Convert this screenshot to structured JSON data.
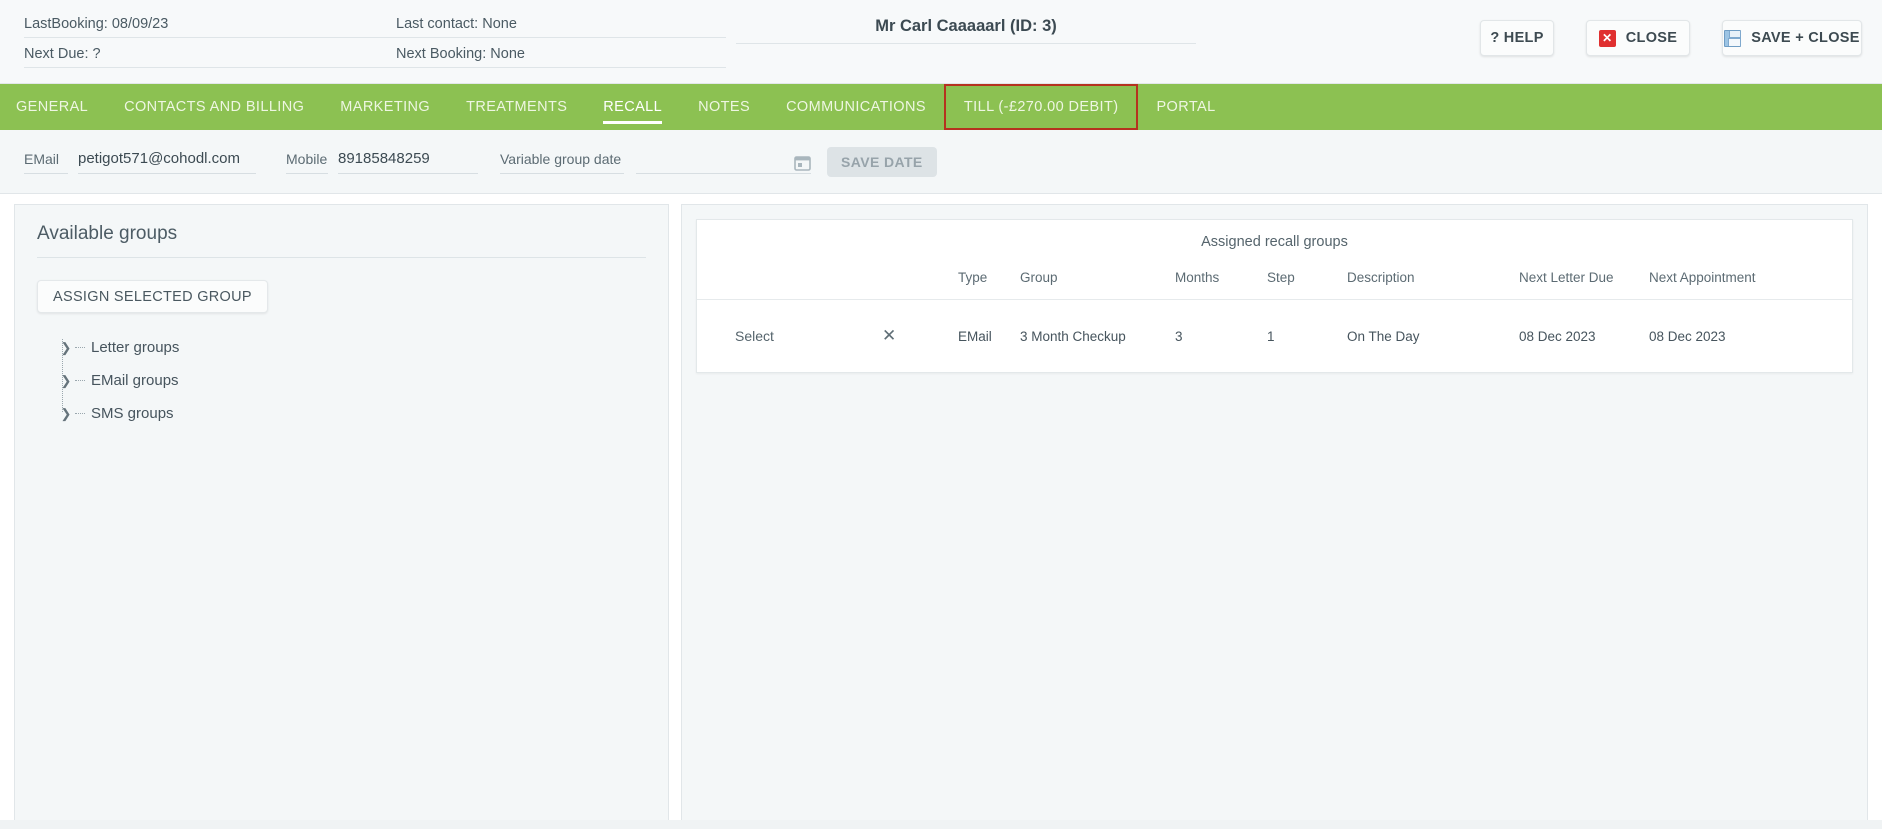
{
  "header": {
    "info_left": [
      "LastBooking: 08/09/23",
      "Next Due: ?"
    ],
    "info_mid": [
      "Last contact: None",
      "Next Booking: None"
    ],
    "patient_title": "Mr Carl Caaaaarl (ID: 3)",
    "buttons": {
      "help": "? HELP",
      "close": "CLOSE",
      "save_close": "SAVE + CLOSE"
    },
    "icons": {
      "close": "close-x-icon",
      "save": "floppy-disk-icon"
    }
  },
  "tabs": [
    {
      "label": "GENERAL",
      "active": false,
      "boxed": false
    },
    {
      "label": "CONTACTS AND BILLING",
      "active": false,
      "boxed": false
    },
    {
      "label": "MARKETING",
      "active": false,
      "boxed": false
    },
    {
      "label": "TREATMENTS",
      "active": false,
      "boxed": false
    },
    {
      "label": "RECALL",
      "active": true,
      "boxed": false
    },
    {
      "label": "NOTES",
      "active": false,
      "boxed": false
    },
    {
      "label": "COMMUNICATIONS",
      "active": false,
      "boxed": false
    },
    {
      "label": "TILL (-£270.00 DEBIT)",
      "active": false,
      "boxed": true
    },
    {
      "label": "PORTAL",
      "active": false,
      "boxed": false
    }
  ],
  "form": {
    "email_label": "EMail",
    "email_value": "petigot571@cohodl.com",
    "mobile_label": "Mobile",
    "mobile_value": "89185848259",
    "variable_group_date_label": "Variable group date",
    "date_value": "",
    "date_placeholder": "",
    "calendar_icon": "calendar-icon",
    "save_date_label": "SAVE DATE",
    "save_date_enabled": false
  },
  "left_panel": {
    "title": "Available groups",
    "assign_button": "ASSIGN SELECTED GROUP",
    "tree": [
      {
        "label": "Letter groups",
        "expanded": false
      },
      {
        "label": "EMail groups",
        "expanded": false
      },
      {
        "label": "SMS groups",
        "expanded": false
      }
    ]
  },
  "right_panel": {
    "caption": "Assigned recall groups",
    "columns": [
      "",
      "",
      "Type",
      "Group",
      "Months",
      "Step",
      "Description",
      "Next Letter Due",
      "Next Appointment"
    ],
    "rows": [
      {
        "select": "Select",
        "remove": "✕",
        "type": "EMail",
        "group": "3 Month Checkup",
        "months": "3",
        "step": "1",
        "description": "On The Day",
        "next_letter_due": "08 Dec 2023",
        "next_appointment": "08 Dec 2023"
      }
    ]
  },
  "colors": {
    "tab_green": "#8cc152",
    "highlight_red": "#b5331f",
    "close_red": "#e03030",
    "panel_bg": "#f4f7f8"
  }
}
